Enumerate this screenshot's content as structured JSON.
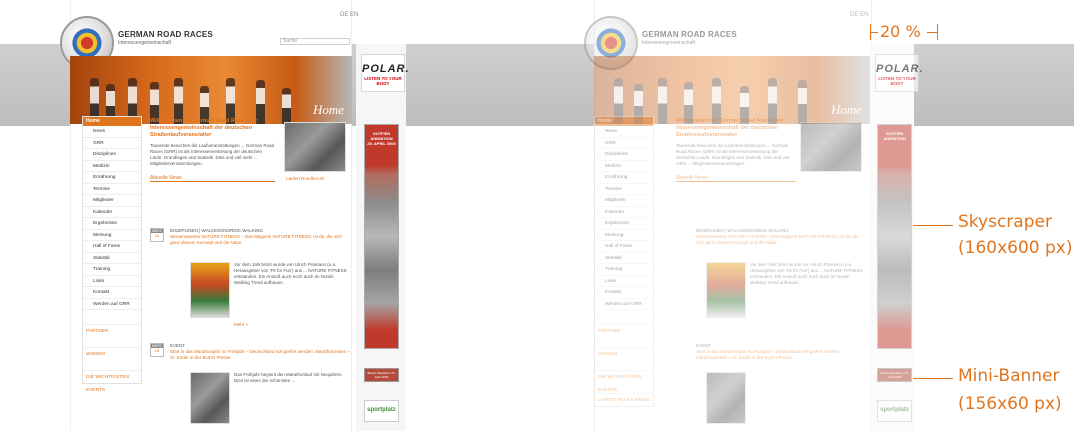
{
  "site": {
    "title": "GERMAN ROAD RACES",
    "subtitle": "Interessengemeinschaft",
    "flags": "DE EN",
    "search_placeholder": "Suche",
    "banner_word": "Home"
  },
  "ads": {
    "polar_logo": "POLAR.",
    "polar_tag": "LISTEN TO YOUR BODY",
    "sky_title": "GUTFIEN ANIMATION",
    "sky_sub": "25. APRIL 2009",
    "mini_text": "Boston Marathon 26. April 2009",
    "sports_logo": "sportplatz"
  },
  "nav": {
    "top": "Home",
    "items": [
      "News",
      "GRR",
      "Disziplinen",
      "Medizin",
      "Ernährung",
      "Termine",
      "Mitglieder",
      "Kalender",
      "Ergebnisse",
      "Meinung",
      "Hall of Fame",
      "Statistik",
      "Training",
      "Links",
      "Kontakt",
      "Werden auf GRR"
    ],
    "sections": [
      "PARTNER",
      "WISSEN",
      "DIE WICHTIGSTEN EVENTS",
      "LATEST TRAILS NEWS"
    ]
  },
  "content": {
    "heading": "Willkommen bei German Road Races der Interessengemeinschaft der deutschen Straßenlaufveranstalter",
    "body": "Tausende besuchen die Laufveranstaltungen ... German Road Races (GRR) ist als Interessenvertretung der deutschen Läufe. Grundlagen und Statistik. Dies und viel mehr ... Mitgliederversammlungen.",
    "section1": "Aktuelle News",
    "news1_tag": "DISZIPLINEN | WALKING/NORDIC WALKING",
    "news1_title": "Wissenswertes NATURE FITNESS – Das Magazin NATURE FITNESS, ist da, die sich ganz diesem Konzept und die Natur",
    "news1_body": "Vor dem Jahrzehnt wurde von Ulrich Pramann (u.a. Herausgeber von 'Fit for Fun') aus ... NATURE FITNESS entstanden. Ein Anstoß auch noch auch im Nordic Walking Trend aufbauen.",
    "more": "Mehr »",
    "news2_tag": "EVENT",
    "news2_title": "Start in das Marathonjahr im Frühjahr – Deutschland soll geehrt werden: Marathonzeiten – St. Ender in der BUCH Presse",
    "news2_body": "Das Frühjahr beginnt den Marathonlauf mit Neujahren. Dies ist eines der schönsten ...",
    "photo_caption": "Laufen Rundherum",
    "date1_m": "MÄRZ",
    "date1_d": "16",
    "date2_m": "MÄRZ",
    "date2_d": "16"
  },
  "annotations": {
    "percent": "20 %",
    "skyscraper": "Skyscraper",
    "skyscraper_size": "(160x600 px)",
    "minibanner": "Mini-Banner",
    "minibanner_size": "(156x60 px)"
  },
  "colors": {
    "accent": "#e0751e",
    "gray": "#c9c9c9"
  }
}
